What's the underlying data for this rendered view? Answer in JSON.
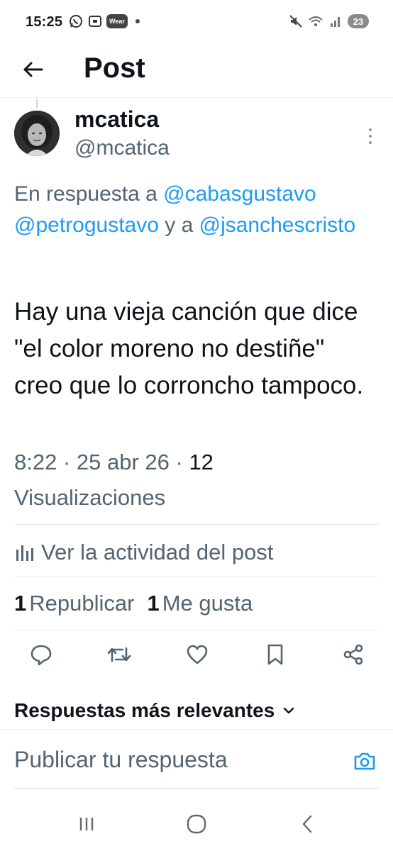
{
  "status_bar": {
    "time": "15:25",
    "wear_label": "Wear",
    "battery": "23",
    "icons": [
      "whatsapp-icon",
      "screenshot-icon",
      "wear-icon",
      "notification-dot-icon",
      "mute-icon",
      "wifi-icon",
      "signal-icon",
      "battery-icon"
    ]
  },
  "header": {
    "title": "Post",
    "back_icon": "arrow-left-icon"
  },
  "post": {
    "author": {
      "display_name": "mcatica",
      "handle": "@mcatica"
    },
    "reply_to": {
      "prefix": "En respuesta a ",
      "mention_1": "@cabasgustavo",
      "mention_2": "@petrogustavo",
      "connector": " y a ",
      "mention_3": "@jsanchescristo"
    },
    "text": "Hay una vieja canción que dice \"el color moreno no destiñe\" creo que lo corroncho tampoco.",
    "timestamp": "8:22 · 25 abr 26 · ",
    "views_count": "12",
    "views_label": "Visualizaciones"
  },
  "activity": {
    "label": "Ver la actividad del post",
    "icon": "analytics-icon"
  },
  "stats": {
    "reposts_count": "1",
    "reposts_label": "Republicar",
    "likes_count": "1",
    "likes_label": "Me gusta"
  },
  "actions": {
    "icons": [
      "reply-icon",
      "repost-icon",
      "like-icon",
      "bookmark-icon",
      "share-icon"
    ]
  },
  "replies_sort": {
    "label": "Respuestas más relevantes",
    "icon": "chevron-down-icon"
  },
  "reply_box": {
    "placeholder": "Publicar tu respuesta",
    "camera_icon": "camera-icon"
  },
  "nav_bar": {
    "icons": [
      "recents-icon",
      "home-icon",
      "back-icon"
    ]
  },
  "colors": {
    "link": "#1d9bf0",
    "secondary_text": "#536471",
    "primary_text": "#0f1419",
    "divider": "#e6ecf0"
  }
}
